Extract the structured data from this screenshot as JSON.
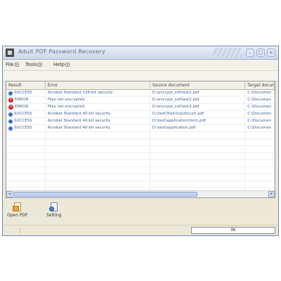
{
  "window": {
    "title": "Adult PDF Password Recovery"
  },
  "menu": {
    "items": [
      {
        "label": "File"
      },
      {
        "label": "Tools"
      },
      {
        "label": "Help"
      }
    ]
  },
  "table": {
    "columns": [
      "Result",
      "Error",
      "Source document",
      "Target docum"
    ],
    "rows": [
      {
        "status": "ok",
        "result": "SUCCESS",
        "error": "Acrobat Standard 128-bit security",
        "source": "D:\\encrypt_sof\\test1.pdf",
        "target": "C:\\Documen"
      },
      {
        "status": "err",
        "result": "ERROR",
        "error": "Files not encrypted",
        "source": "D:\\encrypt_sof\\test2.pdf",
        "target": "C:\\Documen"
      },
      {
        "status": "err",
        "result": "ERROR",
        "error": "Files not encrypted",
        "source": "D:\\encrypt_sof\\test3.pdf",
        "target": "C:\\Documen"
      },
      {
        "status": "ok",
        "result": "SUCCESS",
        "error": "Acrobat Standard 40-bit security",
        "source": "D:\\test\\Training\\docum.pdf",
        "target": "C:\\Documen"
      },
      {
        "status": "ok",
        "result": "SUCCESS",
        "error": "Acrobat Standard 40-bit security",
        "source": "D:\\test\\application\\form.pdf",
        "target": "C:\\Documen"
      },
      {
        "status": "ok",
        "result": "SUCCESS",
        "error": "Acrobat Standard 40-bit security",
        "source": "D:\\test\\application.pdf",
        "target": "C:\\Documen"
      }
    ]
  },
  "toolbar": {
    "open_label": "Open PDF",
    "settings_label": "Setting"
  },
  "statusbar": {
    "value": "0k"
  },
  "icons": {
    "app": "app-icon",
    "ok": "info-icon",
    "err": "error-icon",
    "open": "open-pdf-icon",
    "settings": "settings-icon"
  },
  "colors": {
    "accent": "#3b6fc7",
    "error": "#c62828",
    "titlebar": "#cdd8ea"
  }
}
